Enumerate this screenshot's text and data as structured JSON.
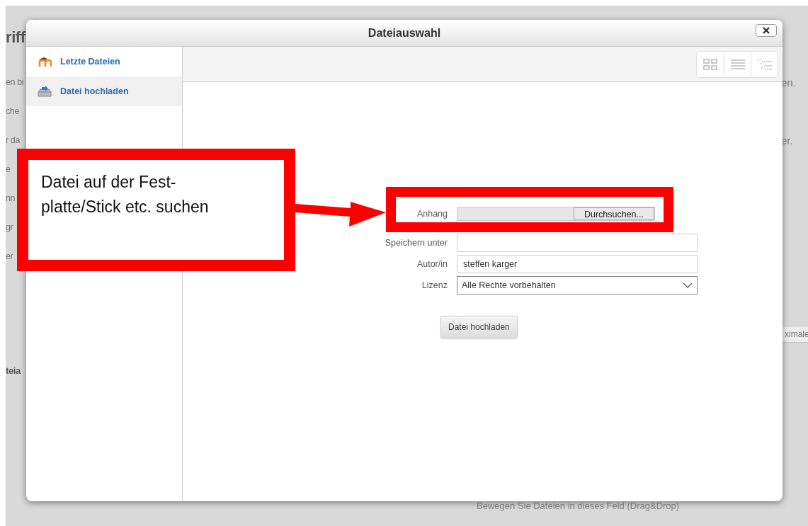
{
  "background": {
    "left_fragments": [
      {
        "text": "riff",
        "kind": "heading"
      },
      {
        "text": "en bi",
        "kind": "line"
      },
      {
        "text": "che",
        "kind": "line"
      },
      {
        "text": "r da",
        "kind": "line"
      },
      {
        "text": "e",
        "kind": "line"
      },
      {
        "text": "nn",
        "kind": "line"
      },
      {
        "text": "gr",
        "kind": "line"
      },
      {
        "text": "er",
        "kind": "line"
      },
      {
        "text": "teia",
        "kind": "subheading"
      }
    ],
    "right_fragments": [
      {
        "text": "en.",
        "kind": "line"
      },
      {
        "text": "er.",
        "kind": "line"
      },
      {
        "text": "ximale",
        "kind": "field"
      }
    ],
    "drop_hint": "Bewegen Sie Dateien in dieses Feld (Drag&Drop)"
  },
  "dialog": {
    "title": "Dateiauswahl",
    "sidebar": {
      "items": [
        {
          "label": "Letzte Dateien",
          "kind": "recent",
          "selected": false
        },
        {
          "label": "Datei hochladen",
          "kind": "upload",
          "selected": true
        }
      ]
    },
    "view_buttons": [
      {
        "kind": "icons"
      },
      {
        "kind": "list"
      },
      {
        "kind": "tree"
      }
    ],
    "form": {
      "fields": [
        {
          "label": "Anhang",
          "kind": "file",
          "button": "Durchsuchen..."
        },
        {
          "label": "Speichern unter",
          "kind": "text"
        },
        {
          "label": "Autor/in",
          "kind": "text",
          "value": "steffen karger"
        },
        {
          "label": "Lizenz",
          "kind": "select",
          "value": "Alle Rechte vorbehalten"
        }
      ],
      "submit": "Datei hochladen"
    }
  },
  "annotation": {
    "lines": [
      "Datei auf der Fest-",
      "platte/Stick etc. suchen"
    ]
  }
}
